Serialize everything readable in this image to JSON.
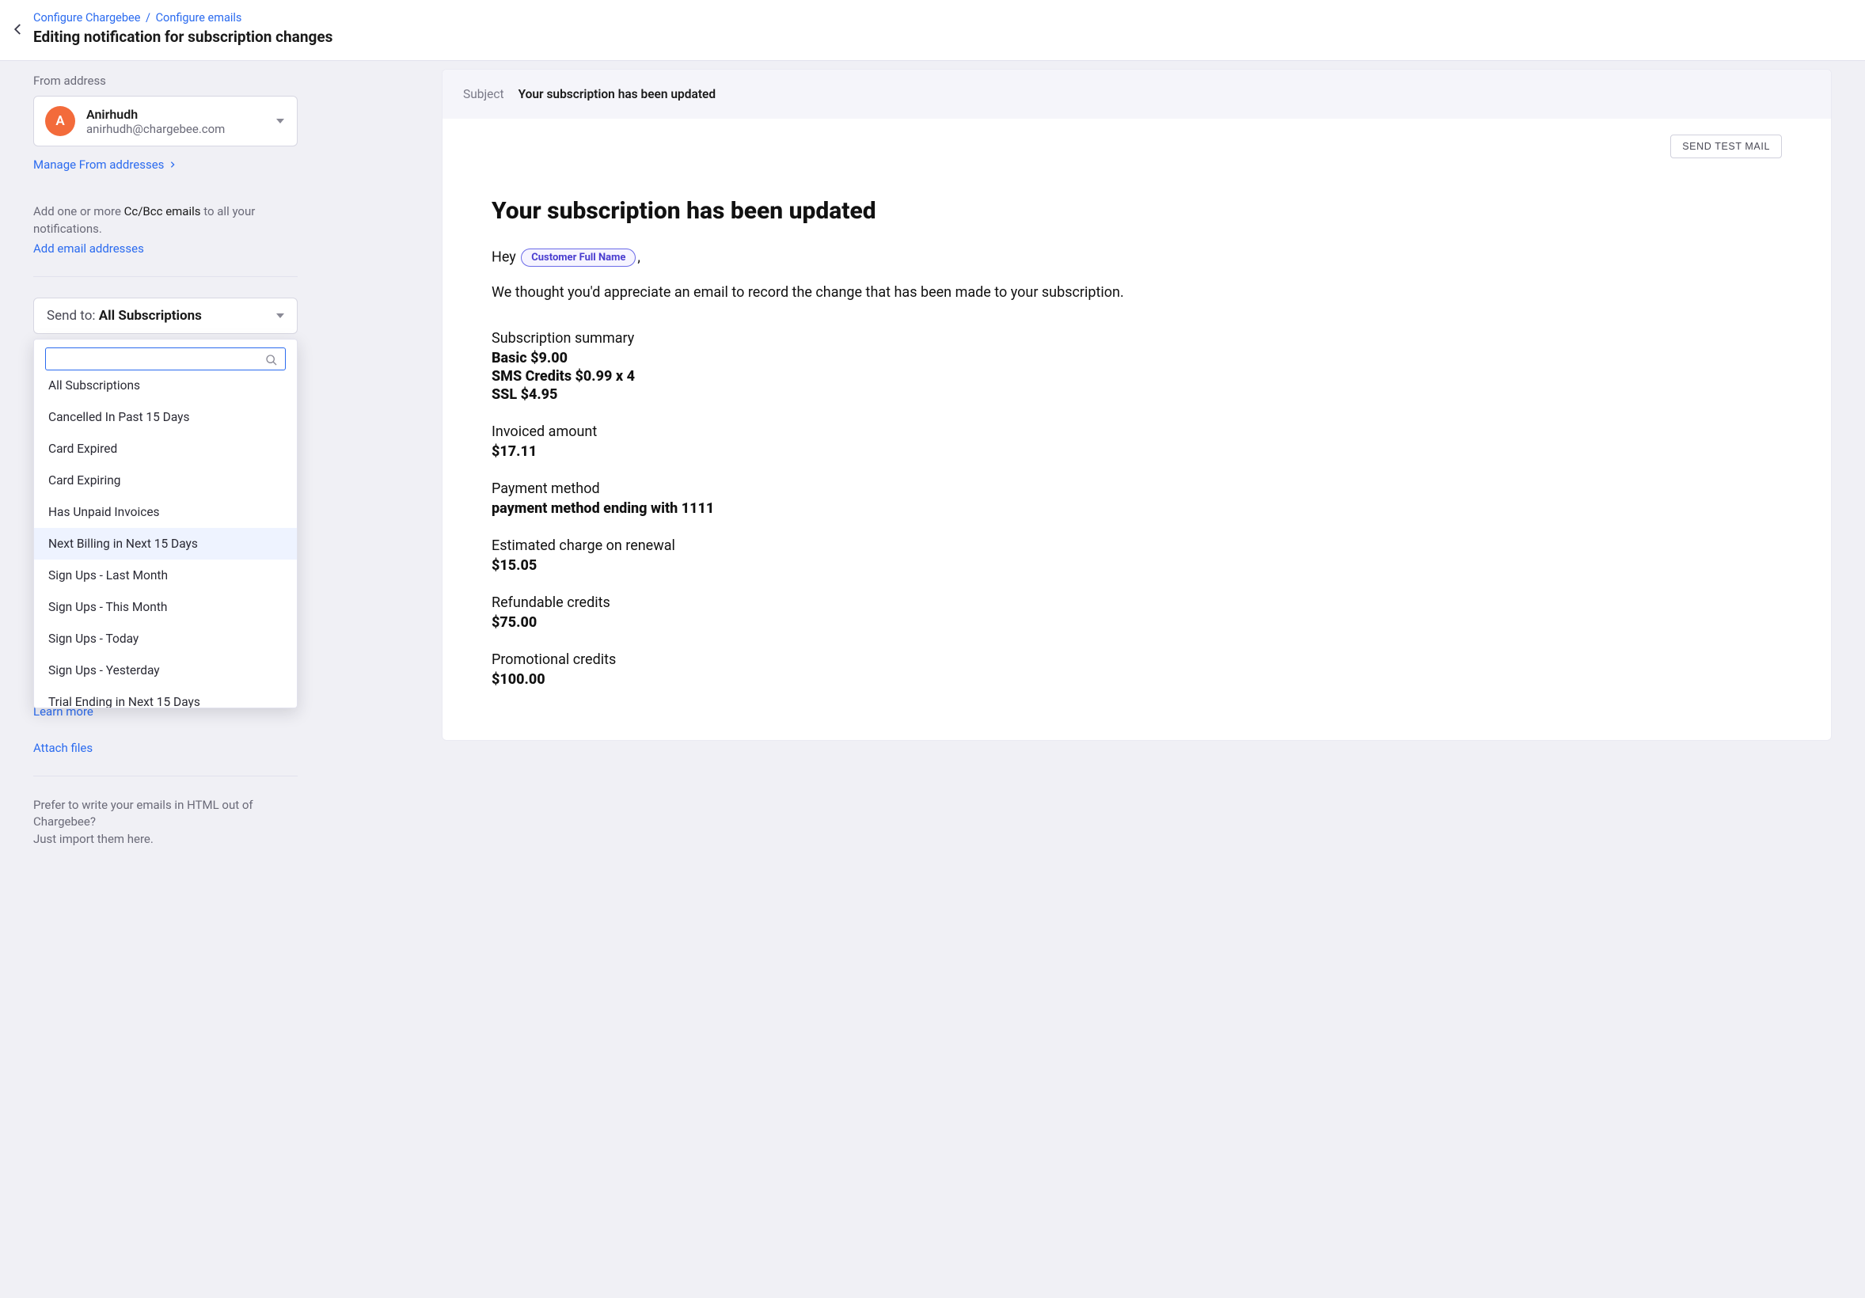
{
  "header": {
    "breadcrumb": [
      "Configure Chargebee",
      "Configure emails"
    ],
    "title": "Editing notification for subscription changes"
  },
  "left": {
    "from_label": "From address",
    "from_name": "Anirhudh",
    "from_email": "anirhudh@chargebee.com",
    "from_initial": "A",
    "manage_from_link": "Manage From addresses",
    "cc_hint_prefix": "Add one or more ",
    "cc_hint_bold": "Cc/Bcc emails",
    "cc_hint_suffix": " to all your notifications.",
    "add_email_link": "Add email addresses",
    "sendto_label": "Send to: ",
    "sendto_value": "All Subscriptions",
    "dropdown_items": [
      "All Subscriptions",
      "Cancelled In Past 15 Days",
      "Card Expired",
      "Card Expiring",
      "Has Unpaid Invoices",
      "Next Billing in Next 15 Days",
      "Sign Ups - Last Month",
      "Sign Ups - This Month",
      "Sign Ups - Today",
      "Sign Ups - Yesterday",
      "Trial Ending in Next 15 Days"
    ],
    "dropdown_hover_index": 5,
    "learn_more": "Learn more",
    "attach_files": "Attach files",
    "import_hint_line1": "Prefer to write your emails in HTML out of Chargebee?",
    "import_hint_line2": "Just import them here."
  },
  "preview": {
    "subject_label": "Subject",
    "subject_value": "Your subscription has been updated",
    "send_test": "SEND TEST MAIL",
    "heading": "Your subscription has been updated",
    "greeting_pre": "Hey ",
    "merge_tag": "Customer Full Name",
    "greeting_post": ",",
    "intro": "We thought you'd appreciate an email to record the change that has been made to your subscription.",
    "summary_label": "Subscription summary",
    "summary_lines": [
      "Basic $9.00",
      "SMS Credits $0.99 x 4",
      "SSL $4.95"
    ],
    "blocks": [
      {
        "label": "Invoiced amount",
        "value": "$17.11"
      },
      {
        "label": "Payment method",
        "value": "payment method ending with 1111"
      },
      {
        "label": "Estimated charge on renewal",
        "value": "$15.05"
      },
      {
        "label": "Refundable credits",
        "value": "$75.00"
      },
      {
        "label": "Promotional credits",
        "value": "$100.00"
      }
    ]
  }
}
